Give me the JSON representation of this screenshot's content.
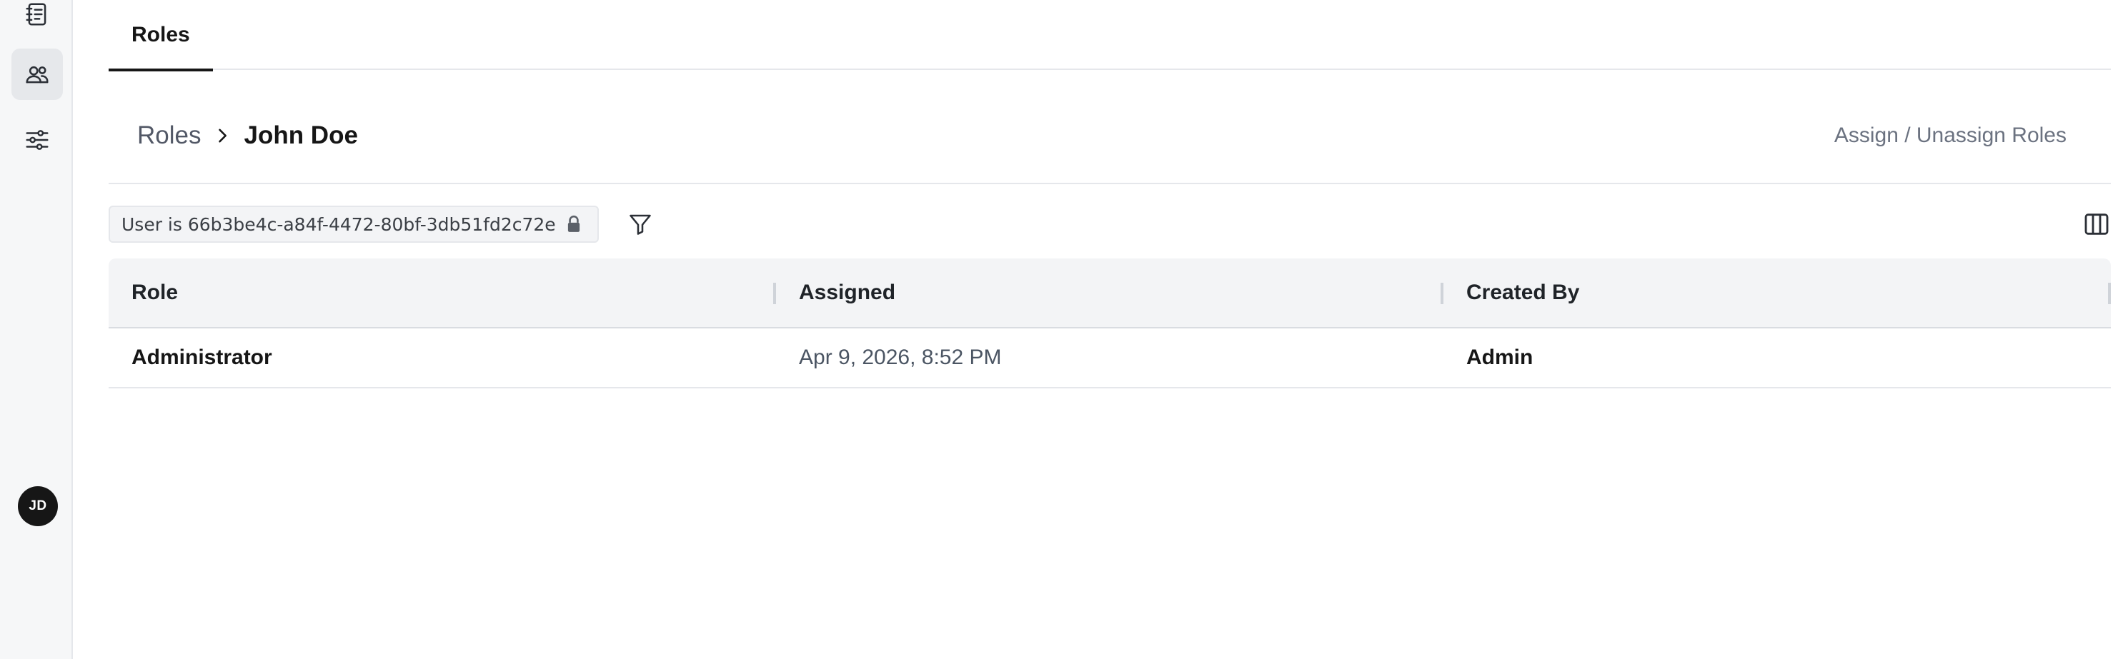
{
  "sidebar": {
    "items": [
      {
        "name": "notebook",
        "icon": "notebook-icon"
      },
      {
        "name": "users",
        "icon": "users-icon",
        "active": true
      },
      {
        "name": "settings",
        "icon": "sliders-icon"
      }
    ],
    "avatar_initials": "JD"
  },
  "tabs": [
    {
      "label": "Roles",
      "active": true
    }
  ],
  "breadcrumb": {
    "parent": "Roles",
    "separator_icon": "chevron-right-icon",
    "current": "John Doe"
  },
  "header": {
    "action_label": "Assign / Unassign Roles"
  },
  "filter": {
    "chip_label": "User is 66b3be4c-a84f-4472-80bf-3db51fd2c72e",
    "chip_icon": "lock-icon",
    "filter_icon": "filter-icon",
    "columns_icon": "columns-icon"
  },
  "table": {
    "columns": [
      "Role",
      "Assigned",
      "Created By"
    ],
    "rows": [
      {
        "role": "Administrator",
        "assigned": "Apr 9, 2026, 8:52 PM",
        "created_by": "Admin"
      }
    ]
  },
  "colors": {
    "sidebar_bg": "#f6f7f8",
    "header_bg": "#f3f4f6",
    "text_primary": "#161616",
    "text_muted": "#6b7280"
  }
}
